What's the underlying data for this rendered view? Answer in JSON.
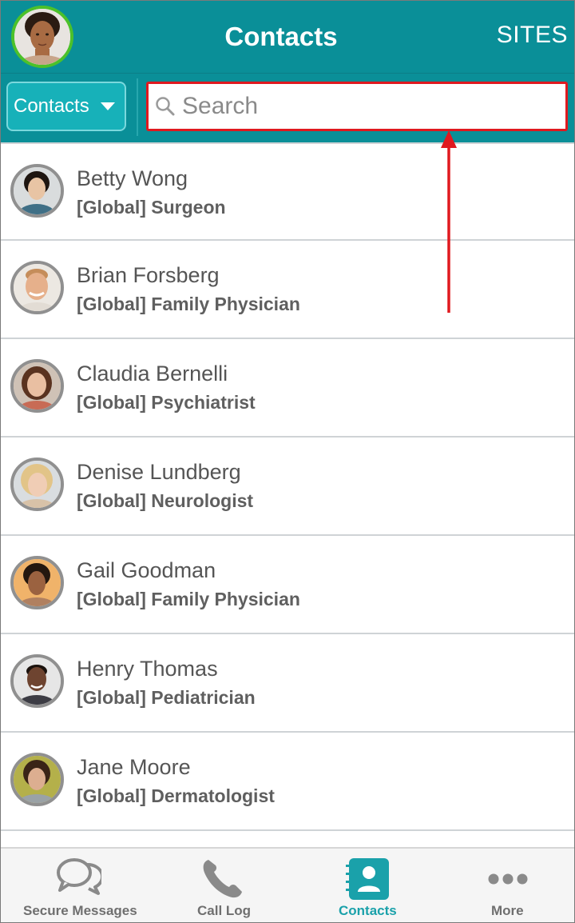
{
  "header": {
    "title": "Contacts",
    "sites_label": "SITES"
  },
  "toolbar": {
    "filter_label": "Contacts",
    "search_placeholder": "Search"
  },
  "contacts": [
    {
      "name": "Betty Wong",
      "role": "[Global] Surgeon"
    },
    {
      "name": "Brian Forsberg",
      "role": "[Global] Family Physician"
    },
    {
      "name": "Claudia Bernelli",
      "role": "[Global] Psychiatrist"
    },
    {
      "name": "Denise Lundberg",
      "role": "[Global] Neurologist"
    },
    {
      "name": "Gail Goodman",
      "role": "[Global] Family Physician"
    },
    {
      "name": "Henry Thomas",
      "role": "[Global] Pediatrician"
    },
    {
      "name": "Jane Moore",
      "role": "[Global] Dermatologist"
    }
  ],
  "tabs": [
    {
      "label": "Secure Messages",
      "icon": "chat-bubbles-icon"
    },
    {
      "label": "Call Log",
      "icon": "phone-icon"
    },
    {
      "label": "Contacts",
      "icon": "contacts-book-icon",
      "active": true
    },
    {
      "label": "More",
      "icon": "ellipsis-icon"
    }
  ],
  "colors": {
    "header_bg": "#0a8f98",
    "accent": "#1aa1aa",
    "highlight_border": "#e0191f",
    "presence_online": "#4cc12a"
  }
}
